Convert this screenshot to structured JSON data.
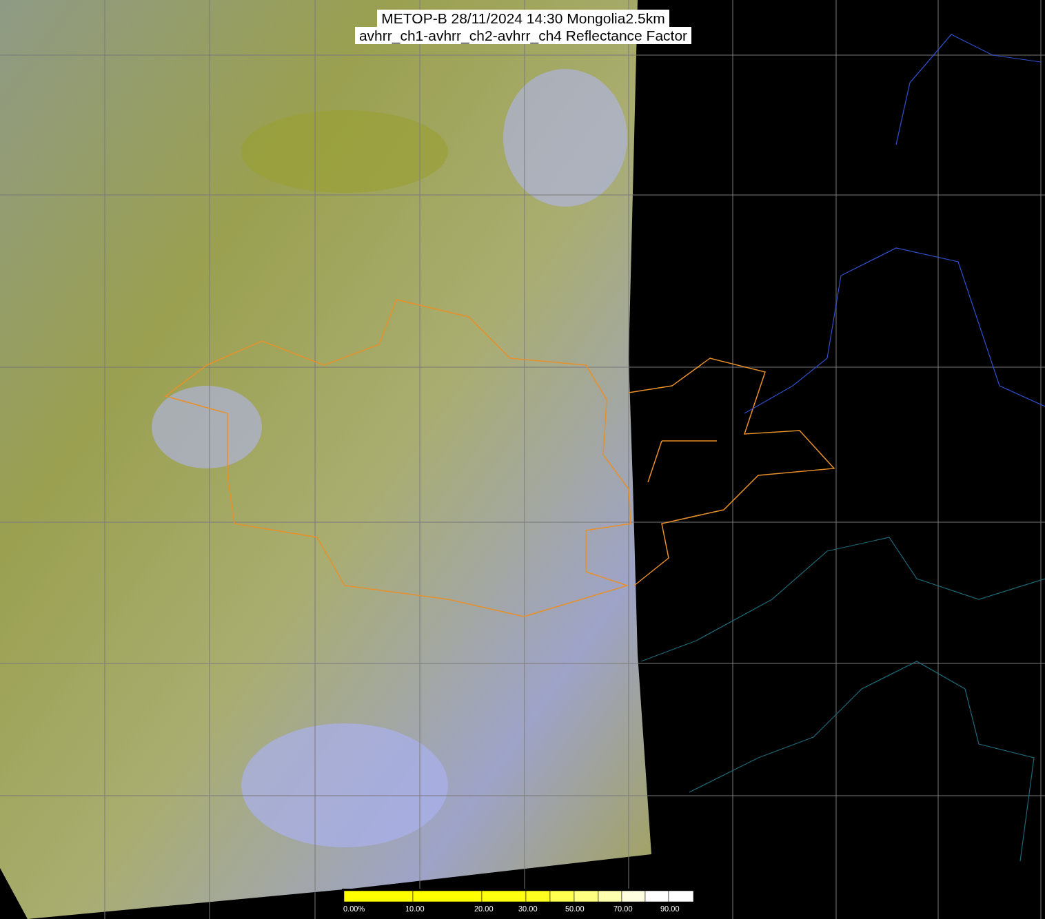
{
  "title": {
    "lines": [
      "METOP-B 28/11/2024 14:30 Mongolia2.5km",
      "avhrr_ch1-avhrr_ch2-avhrr_ch4 Reflectance Factor"
    ]
  },
  "colorbar": {
    "segments": [
      {
        "color": "#ffff00"
      },
      {
        "color": "#ffff00"
      },
      {
        "color": "#ffff10"
      },
      {
        "color": "#ffff20"
      },
      {
        "color": "#ffff50"
      },
      {
        "color": "#ffff80"
      },
      {
        "color": "#ffffb0"
      },
      {
        "color": "#ffffe0"
      },
      {
        "color": "#ffffff"
      },
      {
        "color": "#ffffff"
      }
    ],
    "ticks": [
      "0.00%",
      "10.00",
      "20.00",
      "30.00",
      "50.00",
      "70.00",
      "90.00"
    ]
  }
}
